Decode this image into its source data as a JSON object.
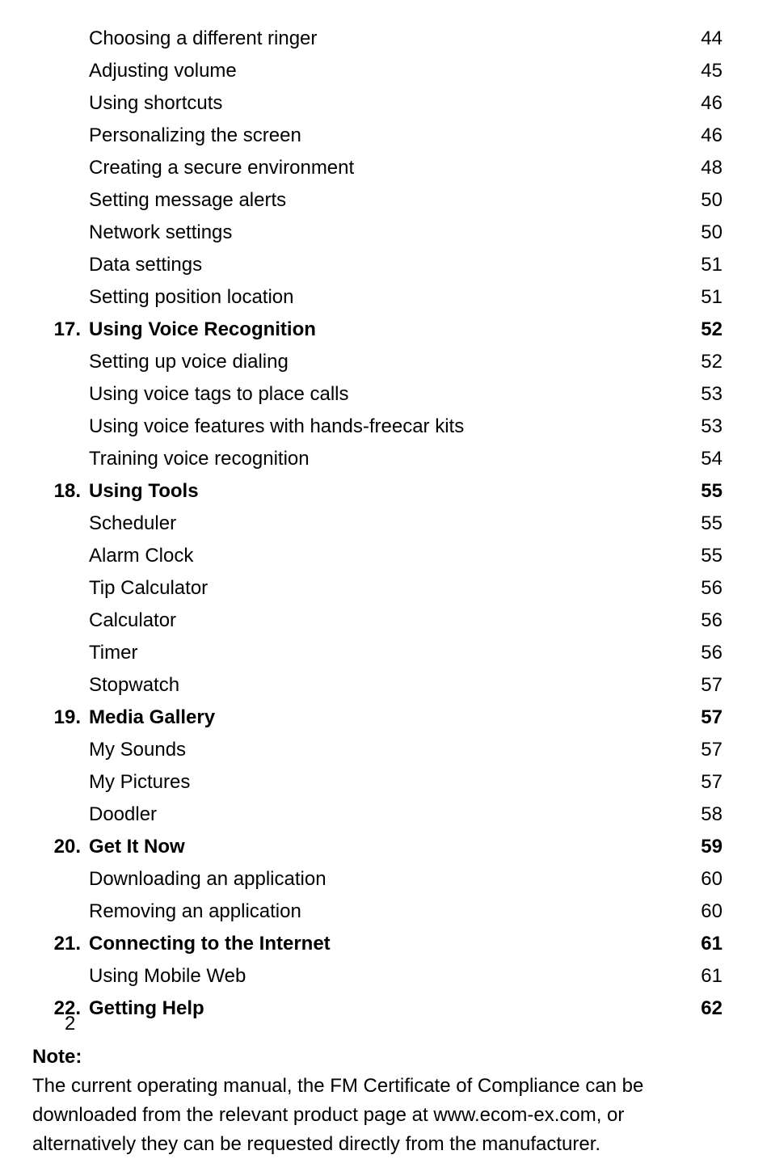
{
  "toc": [
    {
      "num": "",
      "title": "Choosing a different ringer",
      "page": "44",
      "chapter": false
    },
    {
      "num": "",
      "title": "Adjusting volume",
      "page": "45",
      "chapter": false
    },
    {
      "num": "",
      "title": "Using shortcuts",
      "page": "46",
      "chapter": false
    },
    {
      "num": "",
      "title": "Personalizing the screen",
      "page": "46",
      "chapter": false
    },
    {
      "num": "",
      "title": "Creating a secure environment",
      "page": "48",
      "chapter": false
    },
    {
      "num": "",
      "title": "Setting message alerts",
      "page": "50",
      "chapter": false
    },
    {
      "num": "",
      "title": "Network settings",
      "page": "50",
      "chapter": false
    },
    {
      "num": "",
      "title": "Data settings",
      "page": "51",
      "chapter": false
    },
    {
      "num": "",
      "title": "Setting position location",
      "page": "51",
      "chapter": false
    },
    {
      "num": "17.",
      "title": "Using Voice Recognition",
      "page": "52",
      "chapter": true
    },
    {
      "num": "",
      "title": "Setting up voice dialing",
      "page": "52",
      "chapter": false
    },
    {
      "num": "",
      "title": "Using voice tags to place calls",
      "page": "53",
      "chapter": false
    },
    {
      "num": "",
      "title": "Using voice features with hands-freecar kits",
      "page": "53",
      "chapter": false
    },
    {
      "num": "",
      "title": "Training voice recognition",
      "page": "54",
      "chapter": false
    },
    {
      "num": "18.",
      "title": "Using Tools",
      "page": "55",
      "chapter": true
    },
    {
      "num": "",
      "title": "Scheduler",
      "page": "55",
      "chapter": false
    },
    {
      "num": "",
      "title": "Alarm Clock",
      "page": "55",
      "chapter": false
    },
    {
      "num": "",
      "title": "Tip Calculator",
      "page": "56",
      "chapter": false
    },
    {
      "num": "",
      "title": "Calculator",
      "page": "56",
      "chapter": false
    },
    {
      "num": "",
      "title": "Timer",
      "page": "56",
      "chapter": false
    },
    {
      "num": "",
      "title": "Stopwatch",
      "page": "57",
      "chapter": false
    },
    {
      "num": "19.",
      "title": "Media Gallery",
      "page": "57",
      "chapter": true
    },
    {
      "num": "",
      "title": "My Sounds",
      "page": "57",
      "chapter": false
    },
    {
      "num": "",
      "title": "My Pictures",
      "page": "57",
      "chapter": false
    },
    {
      "num": "",
      "title": "Doodler",
      "page": "58",
      "chapter": false
    },
    {
      "num": "20.",
      "title": "Get It Now",
      "page": "59",
      "chapter": true
    },
    {
      "num": "",
      "title": "Downloading an application",
      "page": "60",
      "chapter": false
    },
    {
      "num": "",
      "title": "Removing an application",
      "page": "60",
      "chapter": false
    },
    {
      "num": "21.",
      "title": "Connecting to the Internet",
      "page": "61",
      "chapter": true
    },
    {
      "num": "",
      "title": "Using Mobile Web",
      "page": "61",
      "chapter": false
    },
    {
      "num": "22.",
      "title": "Getting Help",
      "page": "62",
      "chapter": true
    }
  ],
  "note": {
    "label": "Note:",
    "body": "The current operating manual, the FM Certificate of Compliance can be downloaded from the relevant product page at www.ecom-ex.com, or alternatively they can be requested directly from the manufacturer."
  },
  "pageNumber": "2"
}
